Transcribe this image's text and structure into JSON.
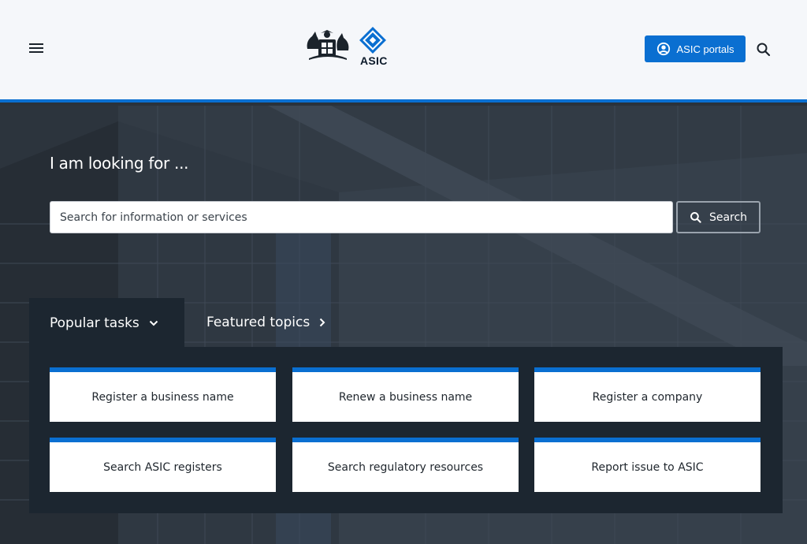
{
  "header": {
    "logo_text": "ASIC",
    "portals_label": "ASIC portals",
    "icons": [
      "menu-icon",
      "account-circle-icon",
      "search-icon"
    ]
  },
  "hero": {
    "heading": "I am looking for ...",
    "search_placeholder": "Search for information or services",
    "search_button": "Search"
  },
  "tabs": {
    "popular": "Popular tasks",
    "featured": "Featured topics"
  },
  "tasks": [
    "Register a business name",
    "Renew a business name",
    "Register a company",
    "Search ASIC registers",
    "Search regulatory resources",
    "Report issue to ASIC"
  ],
  "colors": {
    "accent": "#0a6fd1",
    "header_bg": "#f5f7fa",
    "panel_bg": "#1c2630"
  }
}
